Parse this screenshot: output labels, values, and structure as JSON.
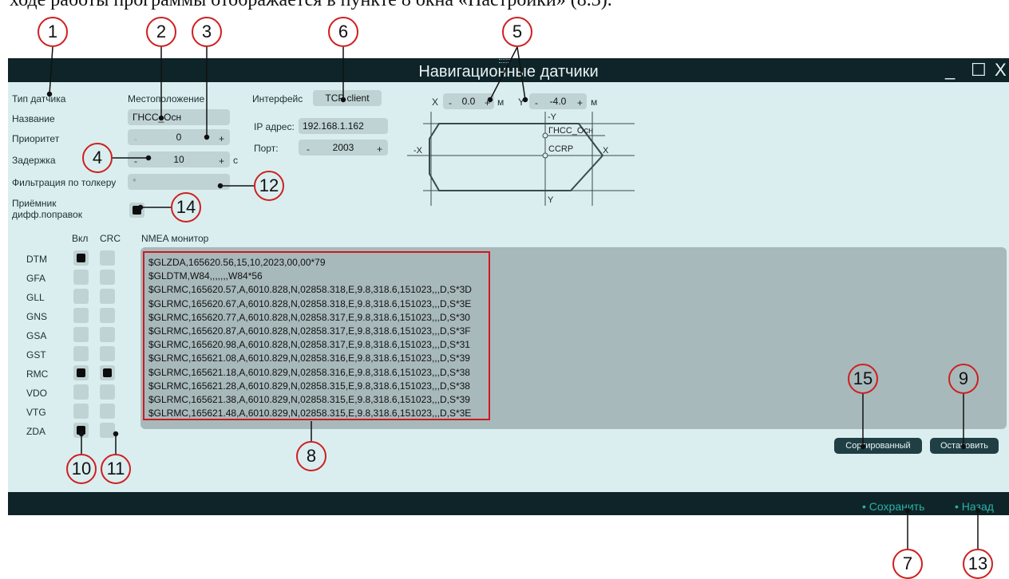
{
  "doc_text": "ходе работы программы отображается в пункте 8 окна «Настройки» (8.3).",
  "window": {
    "title": "Навигационные датчики",
    "minimize": "_",
    "maximize": "☐",
    "close": "X"
  },
  "form": {
    "sensor_type_label": "Тип датчика",
    "location_label": "Местоположение",
    "name_label": "Название",
    "name_value": "ГНСС_Осн",
    "priority_label": "Приоритет",
    "priority_minus": "-",
    "priority_value": "0",
    "priority_plus": "+",
    "delay_label": "Задержка",
    "delay_minus": "-",
    "delay_value": "10",
    "delay_plus": "+",
    "delay_unit": "с",
    "filter_label": "Фильтрация по толкеру",
    "filter_placeholder": "*",
    "receiver_label_1": "Приёмник",
    "receiver_label_2": "дифф.поправок",
    "receiver_checked": true,
    "interface_label": "Интерфейс",
    "interface_value": "TCP client",
    "ip_label": "IP адрес:",
    "ip_value": "192.168.1.162",
    "port_label": "Порт:",
    "port_minus": "-",
    "port_value": "2003",
    "port_plus": "+",
    "x_label": "X",
    "x_minus": "-",
    "x_value": "0.0",
    "x_plus": "+",
    "x_unit": "м",
    "y_label": "Y",
    "y_minus": "-",
    "y_value": "-4.0",
    "y_plus": "+",
    "y_unit": "м"
  },
  "diagram": {
    "neg_y": "-Y",
    "pos_y": "Y",
    "neg_x": "-X",
    "pos_x": "X",
    "sensor_label": "ГНСС_Осн",
    "ref_label": "CCRP"
  },
  "sentences": {
    "col_on": "Вкл",
    "col_crc": "CRC",
    "rows": [
      {
        "name": "DTM",
        "on": true,
        "crc": false
      },
      {
        "name": "GFA",
        "on": false,
        "crc": false
      },
      {
        "name": "GLL",
        "on": false,
        "crc": false
      },
      {
        "name": "GNS",
        "on": false,
        "crc": false
      },
      {
        "name": "GSA",
        "on": false,
        "crc": false
      },
      {
        "name": "GST",
        "on": false,
        "crc": false
      },
      {
        "name": "RMC",
        "on": true,
        "crc": true
      },
      {
        "name": "VDO",
        "on": false,
        "crc": false
      },
      {
        "name": "VTG",
        "on": false,
        "crc": false
      },
      {
        "name": "ZDA",
        "on": true,
        "crc": false
      }
    ]
  },
  "monitor": {
    "title": "NMEA монитор",
    "lines": [
      "$GLZDA,165620.56,15,10,2023,00,00*79",
      "$GLDTM,W84,,,,,,,W84*56",
      "$GLRMC,165620.57,A,6010.828,N,02858.318,E,9.8,318.6,151023,,,D,S*3D",
      "$GLRMC,165620.67,A,6010.828,N,02858.318,E,9.8,318.6,151023,,,D,S*3E",
      "$GLRMC,165620.77,A,6010.828,N,02858.317,E,9.8,318.6,151023,,,D,S*30",
      "$GLRMC,165620.87,A,6010.828,N,02858.317,E,9.8,318.6,151023,,,D,S*3F",
      "$GLRMC,165620.98,A,6010.828,N,02858.317,E,9.8,318.6,151023,,,D,S*31",
      "$GLRMC,165621.08,A,6010.829,N,02858.316,E,9.8,318.6,151023,,,D,S*39",
      "$GLRMC,165621.18,A,6010.829,N,02858.316,E,9.8,318.6,151023,,,D,S*38",
      "$GLRMC,165621.28,A,6010.829,N,02858.315,E,9.8,318.6,151023,,,D,S*38",
      "$GLRMC,165621.38,A,6010.829,N,02858.315,E,9.8,318.6,151023,,,D,S*39",
      "$GLRMC,165621.48,A,6010.829,N,02858.315,E,9.8,318.6,151023,,,D,S*3E"
    ],
    "sorted_button": "Сортированный",
    "stop_button": "Остановить"
  },
  "footer": {
    "save_link": "• Сохранить",
    "back_link": "• Назад"
  },
  "callouts": {
    "c1": "1",
    "c2": "2",
    "c3": "3",
    "c4": "4",
    "c5": "5",
    "c6": "6",
    "c7": "7",
    "c8": "8",
    "c9": "9",
    "c10": "10",
    "c11": "11",
    "c12": "12",
    "c13": "13",
    "c14": "14",
    "c15": "15"
  },
  "colors": {
    "window_bg": "#daeef0",
    "bar_bg": "#0f2428",
    "field_bg": "#bfd3d5",
    "monitor_bg": "#a8b9bb",
    "link": "#27b3a8",
    "callout": "#cf1f1f"
  }
}
